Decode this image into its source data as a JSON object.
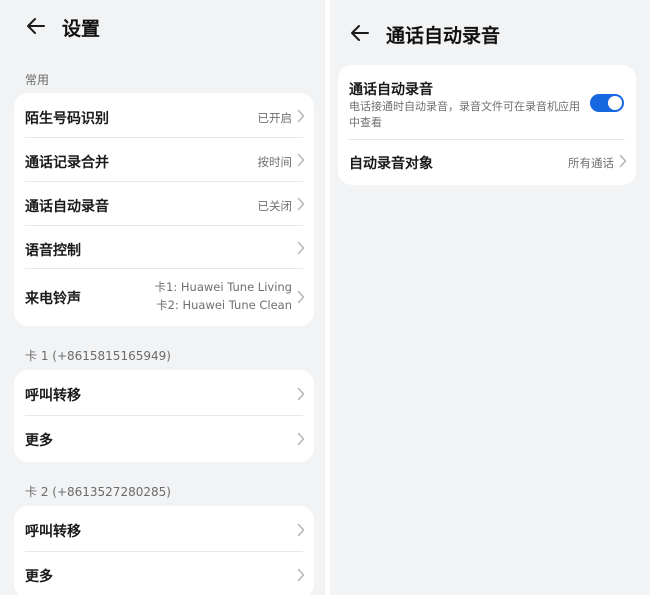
{
  "left": {
    "title": "设置",
    "section_common": "常用",
    "common_items": [
      {
        "label": "陌生号码识别",
        "value": "已开启"
      },
      {
        "label": "通话记录合并",
        "value": "按时间"
      },
      {
        "label": "通话自动录音",
        "value": "已关闭"
      },
      {
        "label": "语音控制",
        "value": ""
      },
      {
        "label": "来电铃声",
        "value_line1": "卡1: Huawei Tune Living",
        "value_line2": "卡2: Huawei Tune Clean"
      }
    ],
    "section_card1": "卡 1 (+8615815165949)",
    "card1_items": [
      {
        "label": "呼叫转移"
      },
      {
        "label": "更多"
      }
    ],
    "section_card2": "卡 2 (+8613527280285)",
    "card2_items": [
      {
        "label": "呼叫转移"
      },
      {
        "label": "更多"
      }
    ]
  },
  "right": {
    "title": "通话自动录音",
    "toggle_item": {
      "label": "通话自动录音",
      "description": "电话接通时自动录音，录音文件可在录音机应用中查看",
      "enabled": true
    },
    "target_item": {
      "label": "自动录音对象",
      "value": "所有通话"
    }
  },
  "colors": {
    "accent": "#1767e0",
    "panel_bg": "#f1f3f5",
    "card_bg": "#ffffff"
  },
  "icons": {
    "back": "arrow-left-icon",
    "chevron": "chevron-right-icon"
  }
}
